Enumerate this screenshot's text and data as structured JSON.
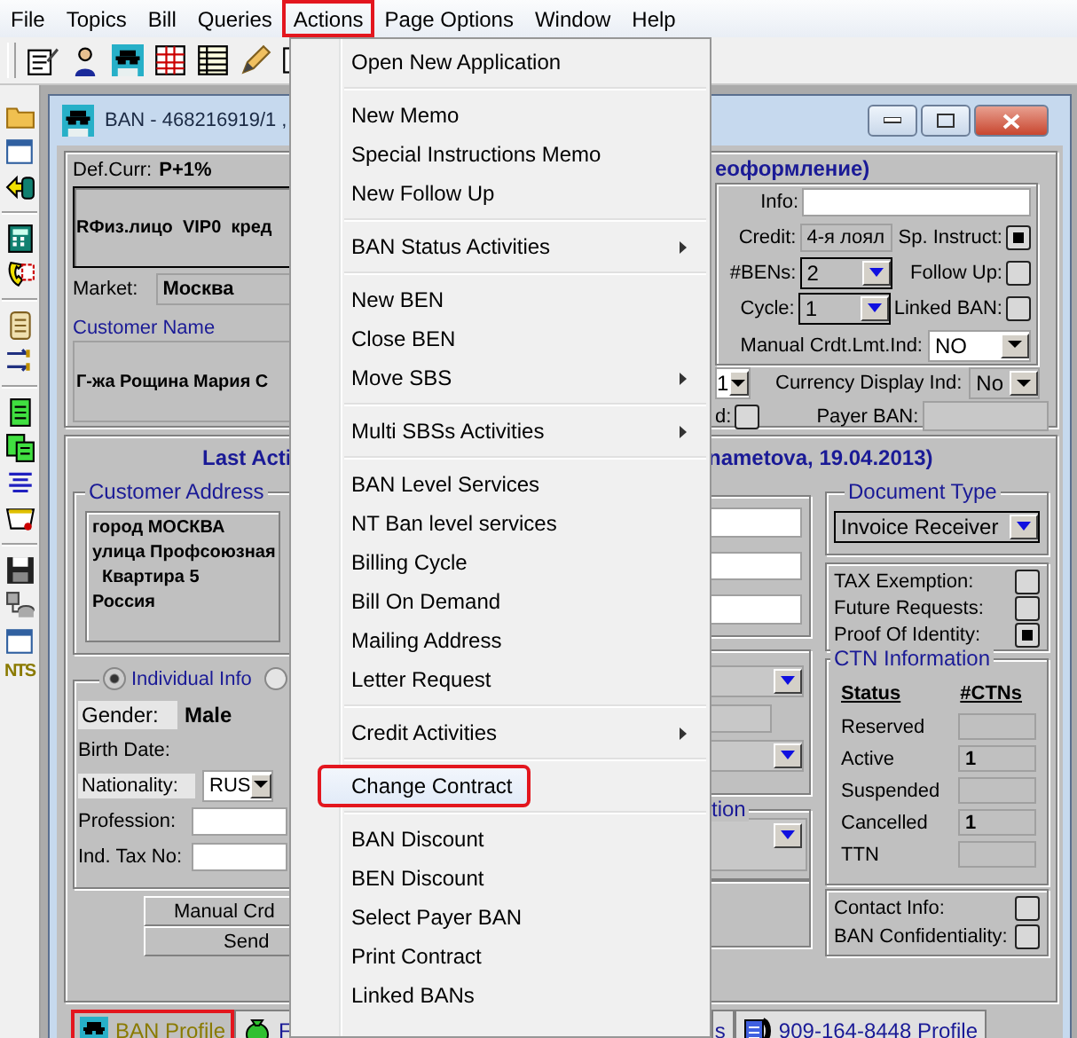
{
  "menubar": [
    {
      "label": "File",
      "marked": false
    },
    {
      "label": "Topics",
      "marked": false
    },
    {
      "label": "Bill",
      "marked": false
    },
    {
      "label": "Queries",
      "marked": false
    },
    {
      "label": "Actions",
      "marked": true
    },
    {
      "label": "Page Options",
      "marked": false
    },
    {
      "label": "Window",
      "marked": false
    },
    {
      "label": "Help",
      "marked": false
    }
  ],
  "sidebar_label": "NTS",
  "window": {
    "title": "BAN - 468216919/1 ,"
  },
  "account_panel": {
    "def_curr_label": "Def.Curr:",
    "def_curr": "P+1%",
    "segment": "RФиз.лицо  VIP0  кред",
    "market_label": "Market:",
    "market": "Москва",
    "customer_name_label": "Customer Name",
    "customer_name": "Г-жа Рощина Мария С",
    "status_heading": "еоформление)",
    "info_label": "Info:",
    "credit_label": "Credit:",
    "credit": "4-я лоял",
    "bens_label": "#BENs:",
    "bens": "2",
    "cycle_label": "Cycle:",
    "cycle": "1",
    "flags": [
      {
        "label": "Sp. Instruct:",
        "checked": true
      },
      {
        "label": "Follow Up:",
        "checked": false
      },
      {
        "label": "Linked BAN:",
        "checked": false
      }
    ],
    "manual_crdt_label": "Manual Crdt.Lmt.Ind:",
    "manual_crdt": "NO",
    "column_1_value": "1",
    "currency_display_label": "Currency Display Ind:",
    "currency_display": "No",
    "column_2": {
      "label": "d:",
      "checked": false
    },
    "payer_ban_label": "Payer BAN:"
  },
  "activity_panel": {
    "heading": "Last Acti",
    "heading_tail": "nametova, 19.04.2013)",
    "address_legend": "Customer Address",
    "address_lines": [
      "город МОСКВА",
      "улица Профсоюзная",
      "  Квартира 5",
      "Россия"
    ],
    "person_options": [
      {
        "label": "Individual Info",
        "selected": true
      },
      {
        "selected": false
      }
    ],
    "gender_label": "Gender:",
    "gender": "Male",
    "birth_date_label": "Birth Date:",
    "nationality_label": "Nationality:",
    "nationality": "RUS",
    "profession_label": "Profession:",
    "ind_tax_label": "Ind. Tax No:",
    "buttons": [
      "Manual Crd",
      "Send"
    ],
    "column_3_legend": "tion",
    "document_type_legend": "Document Type",
    "document_type": "Invoice Receiver",
    "flags": [
      {
        "label": "TAX Exemption:",
        "checked": false
      },
      {
        "label": "Future Requests:",
        "checked": false
      },
      {
        "label": "Proof Of Identity:",
        "checked": true
      }
    ],
    "ctn": {
      "legend": "CTN Information",
      "columns": [
        "Status",
        "#CTNs"
      ],
      "rows": [
        {
          "status": "Reserved"
        },
        {
          "status": "Active",
          "count": "1"
        },
        {
          "status": "Suspended"
        },
        {
          "status": "Cancelled",
          "count": "1"
        },
        {
          "status": "TTN"
        }
      ]
    },
    "contact_flags": [
      {
        "label": "Contact Info:",
        "checked": false
      },
      {
        "label": "BAN Confidentiality:",
        "checked": false
      }
    ]
  },
  "tabs": [
    {
      "label": "BAN Profile",
      "selected": true,
      "marked": true
    },
    {
      "label": "F",
      "selected": false,
      "marked": false
    },
    {
      "label": "s",
      "selected": false,
      "marked": false
    },
    {
      "label": "909-164-8448 Profile",
      "selected": false,
      "marked": false
    }
  ],
  "actions_menu": [
    {
      "kind": "item",
      "label": "Open New Application",
      "submenu": false,
      "hovered": false,
      "marked": false
    },
    {
      "kind": "separator"
    },
    {
      "kind": "item",
      "label": "New Memo",
      "submenu": false,
      "hovered": false,
      "marked": false
    },
    {
      "kind": "item",
      "label": "Special Instructions Memo",
      "submenu": false,
      "hovered": false,
      "marked": false
    },
    {
      "kind": "item",
      "label": "New Follow Up",
      "submenu": false,
      "hovered": false,
      "marked": false
    },
    {
      "kind": "separator"
    },
    {
      "kind": "item",
      "label": "BAN Status Activities",
      "submenu": true,
      "hovered": false,
      "marked": false
    },
    {
      "kind": "separator"
    },
    {
      "kind": "item",
      "label": "New BEN",
      "submenu": false,
      "hovered": false,
      "marked": false
    },
    {
      "kind": "item",
      "label": "Close BEN",
      "submenu": false,
      "hovered": false,
      "marked": false
    },
    {
      "kind": "item",
      "label": "Move SBS",
      "submenu": true,
      "hovered": false,
      "marked": false
    },
    {
      "kind": "separator"
    },
    {
      "kind": "item",
      "label": "Multi SBSs Activities",
      "submenu": true,
      "hovered": false,
      "marked": false
    },
    {
      "kind": "separator"
    },
    {
      "kind": "item",
      "label": "BAN Level Services",
      "submenu": false,
      "hovered": false,
      "marked": false
    },
    {
      "kind": "item",
      "label": "NT Ban level services",
      "submenu": false,
      "hovered": false,
      "marked": false
    },
    {
      "kind": "item",
      "label": "Billing Cycle",
      "submenu": false,
      "hovered": false,
      "marked": false
    },
    {
      "kind": "item",
      "label": "Bill On Demand",
      "submenu": false,
      "hovered": false,
      "marked": false
    },
    {
      "kind": "item",
      "label": "Mailing Address",
      "submenu": false,
      "hovered": false,
      "marked": false
    },
    {
      "kind": "item",
      "label": "Letter Request",
      "submenu": false,
      "hovered": false,
      "marked": false
    },
    {
      "kind": "separator"
    },
    {
      "kind": "item",
      "label": "Credit Activities",
      "submenu": true,
      "hovered": false,
      "marked": false
    },
    {
      "kind": "separator"
    },
    {
      "kind": "item",
      "label": "Change Contract",
      "submenu": false,
      "hovered": true,
      "marked": true
    },
    {
      "kind": "separator"
    },
    {
      "kind": "item",
      "label": "BAN Discount",
      "submenu": false,
      "hovered": false,
      "marked": false
    },
    {
      "kind": "item",
      "label": "BEN Discount",
      "submenu": false,
      "hovered": false,
      "marked": false
    },
    {
      "kind": "item",
      "label": "Select Payer BAN",
      "submenu": false,
      "hovered": false,
      "marked": false
    },
    {
      "kind": "item",
      "label": "Print Contract",
      "submenu": false,
      "hovered": false,
      "marked": false
    },
    {
      "kind": "item",
      "label": "Linked BANs",
      "submenu": false,
      "hovered": false,
      "marked": false
    }
  ]
}
